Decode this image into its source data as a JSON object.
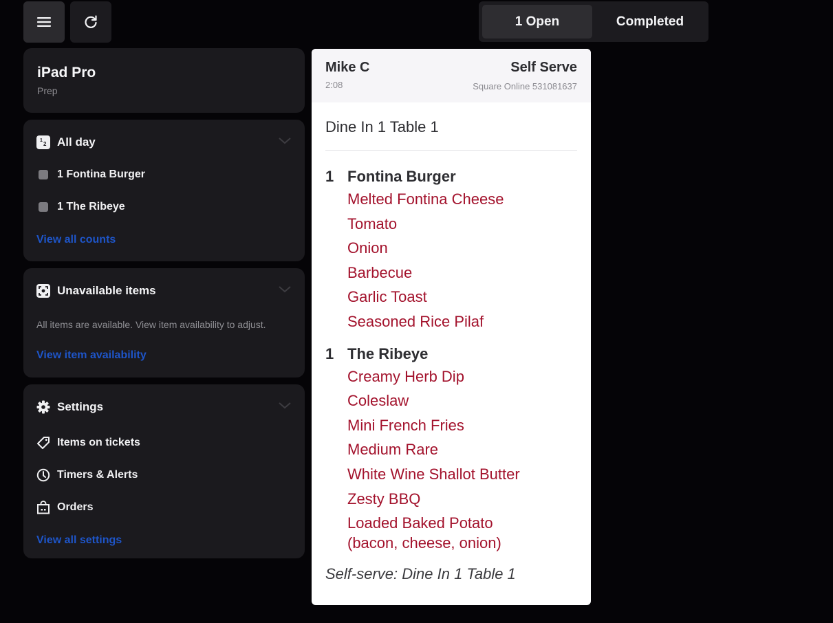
{
  "toolbar": {
    "menu_icon": "hamburger-menu-icon",
    "refresh_icon": "refresh-icon"
  },
  "tabs": [
    {
      "label": "1 Open",
      "active": true
    },
    {
      "label": "Completed",
      "active": false
    }
  ],
  "device": {
    "name": "iPad Pro",
    "station": "Prep"
  },
  "all_day": {
    "title": "All day",
    "icon": "counter-icon",
    "items": [
      {
        "label": "1 Fontina Burger"
      },
      {
        "label": "1 The Ribeye"
      }
    ],
    "link": "View all counts"
  },
  "unavailable": {
    "title": "Unavailable items",
    "icon": "unavailable-items-icon",
    "description": "All items are available. View item availability to adjust.",
    "link": "View item availability"
  },
  "settings": {
    "title": "Settings",
    "icon": "gear-icon",
    "items": [
      {
        "label": "Items on tickets",
        "icon": "tag-icon"
      },
      {
        "label": "Timers & Alerts",
        "icon": "clock-icon"
      },
      {
        "label": "Orders",
        "icon": "bag-icon"
      }
    ],
    "link": "View all settings"
  },
  "ticket": {
    "customer": "Mike C",
    "elapsed": "2:08",
    "type": "Self Serve",
    "source": "Square Online 531081637",
    "table": "Dine In 1 Table 1",
    "items": [
      {
        "qty": "1",
        "name": "Fontina Burger",
        "modifiers": [
          "Melted Fontina Cheese",
          "Tomato",
          "Onion",
          "Barbecue",
          "Garlic Toast",
          "Seasoned Rice Pilaf"
        ]
      },
      {
        "qty": "1",
        "name": "The Ribeye",
        "modifiers": [
          "Creamy Herb Dip",
          "Coleslaw",
          "Mini French Fries",
          "Medium Rare",
          "White Wine Shallot Butter",
          "Zesty BBQ",
          "Loaded Baked Potato (bacon, cheese, onion)"
        ]
      }
    ],
    "note": "Self-serve: Dine In 1 Table 1"
  },
  "colors": {
    "background": "#050407",
    "card": "#1b1a1e",
    "link": "#1e55c9",
    "modifier": "#a3122c"
  }
}
